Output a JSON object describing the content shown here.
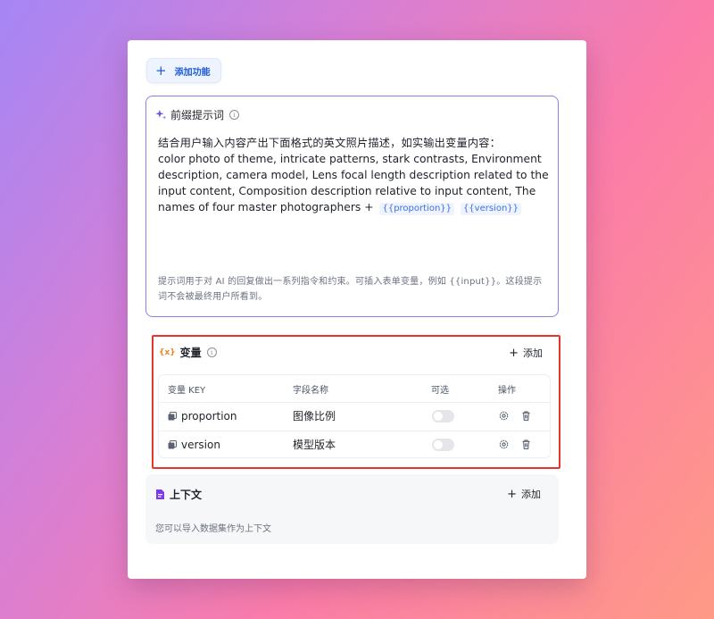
{
  "toolbar": {
    "add_feature_label": "添加功能"
  },
  "prompt": {
    "title": "前缀提示词",
    "line_cn": "结合用户输入内容产出下面格式的英文照片描述，如实输出变量内容：",
    "text_en": "color photo of theme, intricate patterns, stark contrasts, Environment description, camera model, Lens focal length description related to the input content, Composition description relative to input content, The names of four master photographers +",
    "tags": [
      "{{proportion}}",
      "{{version}}"
    ],
    "hint": "提示词用于对 AI 的回复做出一系列指令和约束。可插入表单变量，例如 {{input}}。这段提示词不会被最终用户所看到。",
    "accent_color": "#8b7fe8"
  },
  "variables": {
    "icon_label": "{x}",
    "title": "变量",
    "add_label": "添加",
    "highlight_color": "#e6362b",
    "columns": [
      "变量 KEY",
      "字段名称",
      "可选",
      "操作"
    ],
    "rows": [
      {
        "key": "proportion",
        "name": "图像比例",
        "optional": false
      },
      {
        "key": "version",
        "name": "模型版本",
        "optional": false
      }
    ]
  },
  "context": {
    "title": "上下文",
    "add_label": "添加",
    "hint": "您可以导入数据集作为上下文",
    "icon_color": "#7c3aed"
  }
}
